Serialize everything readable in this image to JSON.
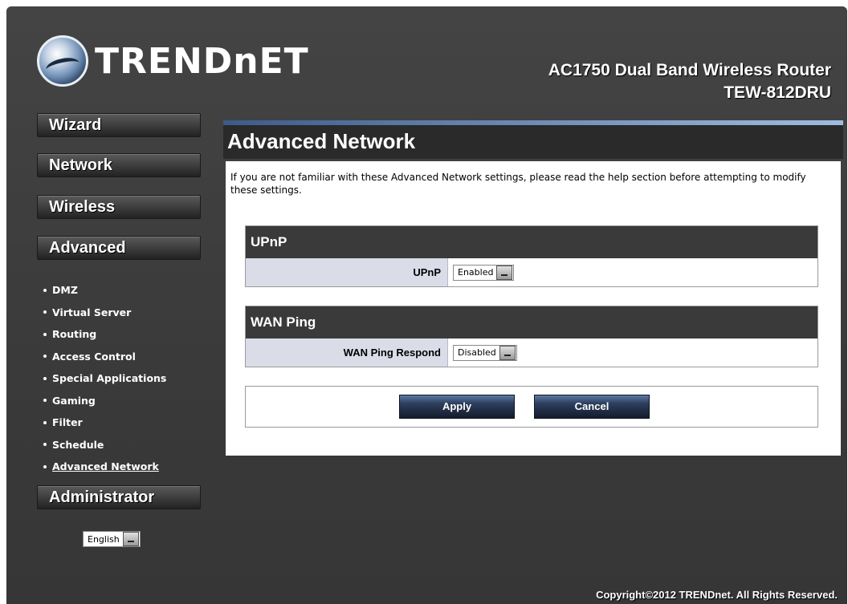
{
  "brand": {
    "logo_text": "TRENDnET",
    "product_line1": "AC1750 Dual Band Wireless Router",
    "product_line2": "TEW-812DRU"
  },
  "sidebar": {
    "wizard": "Wizard",
    "network": "Network",
    "wireless": "Wireless",
    "advanced": "Advanced",
    "advanced_items": [
      "DMZ",
      "Virtual Server",
      "Routing",
      "Access Control",
      "Special Applications",
      "Gaming",
      "Filter",
      "Schedule",
      "Advanced Network"
    ],
    "administrator": "Administrator",
    "language": "English"
  },
  "main": {
    "title": "Advanced Network",
    "intro": "If you are not familiar with these Advanced Network settings, please read the help section before attempting to modify these settings.",
    "upnp": {
      "section_title": "UPnP",
      "label": "UPnP",
      "value": "Enabled"
    },
    "wan_ping": {
      "section_title": "WAN Ping",
      "label": "WAN Ping Respond",
      "value": "Disabled"
    },
    "apply_label": "Apply",
    "cancel_label": "Cancel"
  },
  "footer": {
    "copyright": "Copyright©2012 TRENDnet. All Rights Reserved."
  }
}
